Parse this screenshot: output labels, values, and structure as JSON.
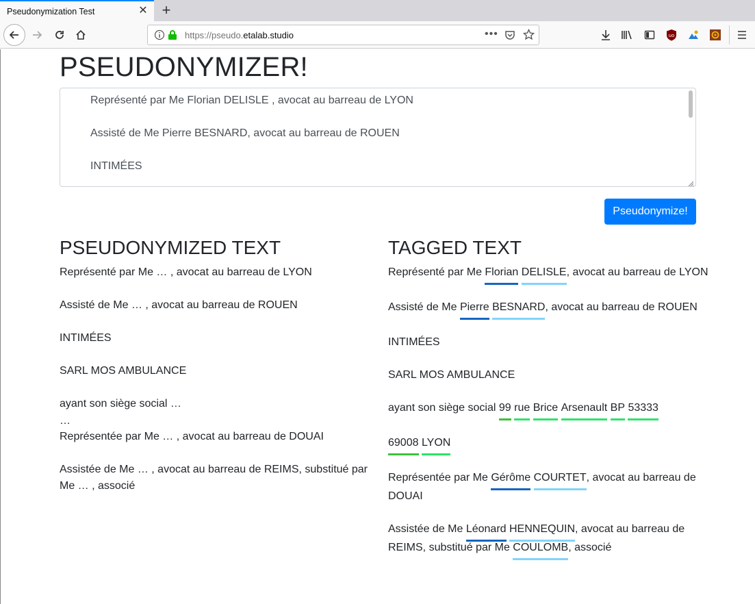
{
  "browser": {
    "tab_title": "Pseudonymization Test",
    "url_prefix": "https://pseudo.",
    "url_host": "etalab.studio"
  },
  "page": {
    "title": "PSEUDONYMIZER!",
    "input_lines": [
      "Représenté par Me Florian DELISLE , avocat au barreau de LYON",
      "Assisté de Me Pierre BESNARD, avocat au barreau de ROUEN",
      "INTIMÉES"
    ],
    "button_label": "Pseudonymize!"
  },
  "pseudonymized": {
    "heading": "PSEUDONYMIZED TEXT",
    "lines": [
      "Représenté par Me … , avocat au barreau de LYON",
      "Assisté de Me … , avocat au barreau de ROUEN",
      "INTIMÉES",
      "SARL MOS AMBULANCE",
      "ayant son siège social …",
      "…",
      "Représentée par Me … , avocat au barreau de DOUAI",
      "Assistée de Me … , avocat au barreau de REIMS, substitué par",
      "Me … , associé"
    ]
  },
  "tagged": {
    "heading": "TAGGED TEXT",
    "l1": {
      "pre": "Représenté par Me ",
      "first": "Florian",
      "last": "DELISLE",
      "post": ", avocat au barreau de LYON"
    },
    "l2": {
      "pre": "Assisté de Me ",
      "first": "Pierre",
      "last": "BESNARD",
      "post": ", avocat au barreau de ROUEN"
    },
    "l3": "INTIMÉES",
    "l4": "SARL MOS AMBULANCE",
    "l5": {
      "pre": "ayant son siège social ",
      "num": "99",
      "w1": "rue",
      "w2": "Brice",
      "w3": "Arsenault",
      "w4": "BP",
      "w5": "53333"
    },
    "l6": {
      "zip": "69008",
      "city": "LYON"
    },
    "l7": {
      "pre": "Représentée par Me ",
      "first": "Gérôme",
      "last": "COURTET",
      "post": ", avocat au barreau de"
    },
    "l8": "DOUAI",
    "l9": {
      "pre": "Assistée de Me ",
      "first": "Léonard",
      "last": "HENNEQUIN",
      "post": ", avocat au barreau de"
    },
    "l10": {
      "pre": "REIMS, substitué par Me ",
      "last": "COULOMB",
      "post": ", associé"
    }
  },
  "colors": {
    "first_name": "#1565c0",
    "last_name": "#81d4fa",
    "number": "#3cc23c",
    "address": "#2ee36a",
    "button": "#007bff"
  }
}
